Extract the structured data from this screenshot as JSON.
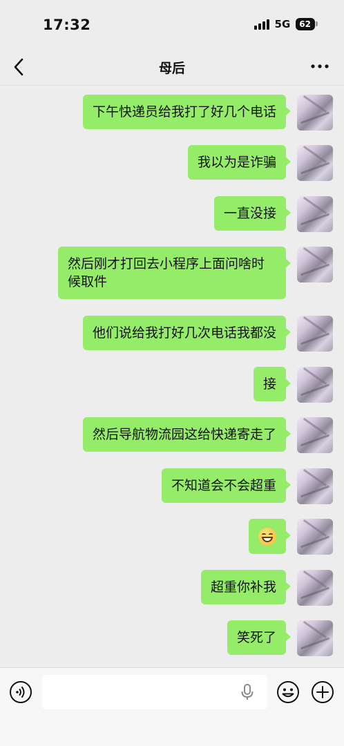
{
  "status": {
    "time": "17:32",
    "network": "5G",
    "battery": "62"
  },
  "nav": {
    "title": "母后",
    "back_icon": "chevron-left-icon",
    "more_icon": "more-dots-icon"
  },
  "messages": [
    {
      "text": "下午快递员给我打了好几个电话"
    },
    {
      "text": "我以为是诈骗"
    },
    {
      "text": "一直没接"
    },
    {
      "text": "然后刚才打回去小程序上面问啥时候取件"
    },
    {
      "text": "他们说给我打好几次电话我都没"
    },
    {
      "text": "接"
    },
    {
      "text": "然后导航物流园这给快递寄走了"
    },
    {
      "text": "不知道会不会超重"
    },
    {
      "text": "",
      "emoji": "grinning-face-emoji"
    },
    {
      "text": "超重你补我"
    },
    {
      "text": "笑死了"
    }
  ],
  "input": {
    "value": "",
    "voice_icon": "voice-icon",
    "mic_icon": "microphone-icon",
    "emoji_icon": "emoji-icon",
    "plus_icon": "plus-icon"
  },
  "colors": {
    "bubble": "#95ec69",
    "background": "#ededed"
  }
}
